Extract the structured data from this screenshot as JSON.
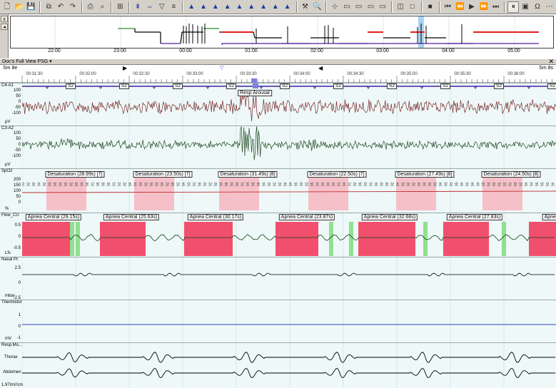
{
  "toolbar": {
    "buttons": [
      {
        "name": "new-icon",
        "glyph": "🗋"
      },
      {
        "name": "open-folder-icon",
        "glyph": "📂"
      },
      {
        "name": "save-icon",
        "glyph": "💾"
      },
      {
        "name": "copy-icon",
        "glyph": "⧉"
      },
      {
        "name": "undo-icon",
        "glyph": "↶"
      },
      {
        "name": "redo-icon",
        "glyph": "↷"
      },
      {
        "name": "print-icon",
        "glyph": "⎙"
      },
      {
        "name": "find-icon",
        "glyph": "⌕"
      },
      {
        "name": "montage-icon",
        "glyph": "⊞"
      },
      {
        "name": "event-down-icon",
        "glyph": "⇟"
      },
      {
        "name": "arrows-icon",
        "glyph": "⇔"
      },
      {
        "name": "filter-icon",
        "glyph": "▽"
      },
      {
        "name": "analysis-icon",
        "glyph": "≡"
      },
      {
        "name": "tool-1-icon",
        "glyph": "▲"
      },
      {
        "name": "tool-2-icon",
        "glyph": "▲"
      },
      {
        "name": "tool-3-icon",
        "glyph": "▲"
      },
      {
        "name": "tool-4-icon",
        "glyph": "▲"
      },
      {
        "name": "tool-5-icon",
        "glyph": "▲"
      },
      {
        "name": "tool-6-icon",
        "glyph": "▲"
      },
      {
        "name": "tool-7-icon",
        "glyph": "▲"
      },
      {
        "name": "tool-8-icon",
        "glyph": "▲"
      },
      {
        "name": "tool-9-icon",
        "glyph": "▲"
      },
      {
        "name": "wrench-icon",
        "glyph": "⚒"
      },
      {
        "name": "zoom-icon",
        "glyph": "🔍"
      },
      {
        "name": "measure-icon",
        "glyph": "⊹"
      },
      {
        "name": "window-1-icon",
        "glyph": "▭"
      },
      {
        "name": "window-2-icon",
        "glyph": "▭"
      },
      {
        "name": "window-3-icon",
        "glyph": "▭"
      },
      {
        "name": "window-4-icon",
        "glyph": "▭"
      },
      {
        "name": "layout-1-icon",
        "glyph": "◫"
      },
      {
        "name": "layout-2-icon",
        "glyph": "□"
      },
      {
        "name": "stop-icon",
        "glyph": "■"
      },
      {
        "name": "first-icon",
        "glyph": "⏮"
      },
      {
        "name": "prev-icon",
        "glyph": "⏪"
      },
      {
        "name": "play-icon",
        "glyph": "▶"
      },
      {
        "name": "fast-forward-icon",
        "glyph": "⏩"
      },
      {
        "name": "next-icon",
        "glyph": "⏭"
      },
      {
        "name": "pause-icon",
        "glyph": "⏸"
      },
      {
        "name": "video-icon",
        "glyph": "▣"
      },
      {
        "name": "headphones-icon",
        "glyph": "Ω"
      },
      {
        "name": "volume-icon",
        "glyph": "⋯"
      }
    ]
  },
  "hypnogram": {
    "side_buttons": [
      "x",
      "◂"
    ],
    "time_labels": [
      "22:00",
      "23:00",
      "00:00",
      "01:00",
      "02:00",
      "03:00",
      "04:00",
      "05:00"
    ]
  },
  "view": {
    "title": "Doc's Full View PSG ▾",
    "close": "✕",
    "epoch_left": "Sm 8e",
    "epoch_right": "Sm 8s"
  },
  "ruler": {
    "times": [
      "00:31:30",
      "00:32:00",
      "00:32:30",
      "00:33:00",
      "00:33:30",
      "00:34:00",
      "00:34:30",
      "00:35:00",
      "00:35:30",
      "00:36:00"
    ]
  },
  "channels": {
    "c4a1": {
      "label": "C4-A1",
      "unit": "μV",
      "ticks": [
        "100",
        "50",
        "0",
        "-50",
        "-100"
      ]
    },
    "c3a2": {
      "label": "C3-A2",
      "unit": "μV",
      "ticks": [
        "100",
        "50",
        "0",
        "-50",
        "-100"
      ]
    },
    "spo2": {
      "label": "SpO2",
      "unit": "%",
      "ticks": [
        "200",
        "150",
        "100",
        "50",
        "0"
      ]
    },
    "flow": {
      "label": "Flow_CU",
      "unit": "Lfs",
      "ticks": [
        "0.5",
        "0",
        "-0.5"
      ]
    },
    "nasal": {
      "label": "Nasal Pr.",
      "unit": "mbar",
      "ticks": [
        "2.5",
        "0",
        "-2.5"
      ]
    },
    "thermistor": {
      "label": "Thermistor",
      "unit": "mV",
      "ticks": [
        "1",
        "0",
        "-1"
      ]
    },
    "resp": {
      "label": "Resp.Mo...",
      "thorax": "Thorax",
      "abdomen": "Abdomen",
      "scale": "1.97mV/cm"
    }
  },
  "stage_tags": [
    "S2",
    "S2",
    "S2",
    "S2",
    "S2",
    "S2",
    "S2",
    "S2",
    "S2",
    "S2"
  ],
  "arousal_label": "Resp Arousal",
  "desaturations": [
    "Desaturation (28.99s) [7]",
    "Desaturation (23.50s) [7]",
    "Desaturation (31.49s) [8]",
    "Desaturation (22.50s) [7]",
    "Desaturation (27.49s) [8]",
    "Desaturation (24.50s) [8]"
  ],
  "apneas": [
    "Apnea Central (29.15s)",
    "Apnea Central (25.63s)",
    "Apnea Central (30.17s)",
    "Apnea Central (23.87s)",
    "Apnea Central (32.66s)",
    "Apnea Central (27.83s)",
    "Apnea Central"
  ],
  "colors": {
    "eeg1": "#7a2a2a",
    "eeg2": "#1f4a1f",
    "apnea": "#f0506e",
    "desat": "#f5c0c8",
    "flow_green": "#90e090",
    "hypno_green": "#2a8a2a",
    "hypno_red": "#e02020",
    "hypno_purple": "#5020a0",
    "hypno_black": "#000000",
    "hypno_cursor": "#8ec8f0"
  }
}
